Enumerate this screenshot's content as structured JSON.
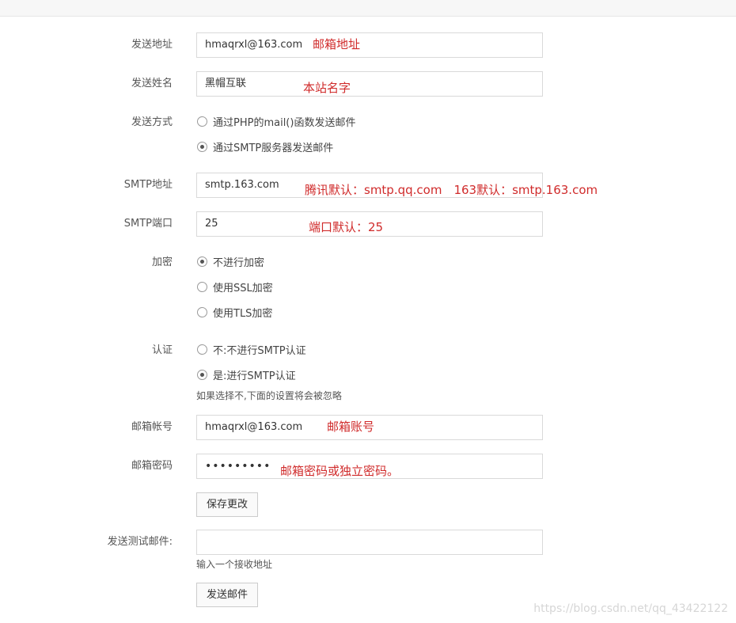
{
  "form": {
    "sender_address": {
      "label": "发送地址",
      "value": "hmaqrxl@163.com",
      "note": "邮箱地址"
    },
    "sender_name": {
      "label": "发送姓名",
      "value": "黑帽互联",
      "note": "本站名字"
    },
    "send_method": {
      "label": "发送方式",
      "options": [
        "通过PHP的mail()函数发送邮件",
        "通过SMTP服务器发送邮件"
      ],
      "selected_index": 1
    },
    "smtp_address": {
      "label": "SMTP地址",
      "value": "smtp.163.com",
      "note": "腾讯默认：smtp.qq.com　163默认：smtp.163.com"
    },
    "smtp_port": {
      "label": "SMTP端口",
      "value": "25",
      "note": "端口默认：25"
    },
    "encryption": {
      "label": "加密",
      "options": [
        "不进行加密",
        "使用SSL加密",
        "使用TLS加密"
      ],
      "selected_index": 0
    },
    "auth": {
      "label": "认证",
      "options": [
        "不:不进行SMTP认证",
        "是:进行SMTP认证"
      ],
      "selected_index": 1,
      "hint": "如果选择不,下面的设置将会被忽略"
    },
    "mail_account": {
      "label": "邮箱帐号",
      "value": "hmaqrxl@163.com",
      "note": "邮箱账号"
    },
    "mail_password": {
      "label": "邮箱密码",
      "value": "•••••••••",
      "note": "邮箱密码或独立密码。"
    },
    "save_button": "保存更改",
    "test_mail": {
      "label": "发送测试邮件:",
      "value": "",
      "hint": "输入一个接收地址"
    },
    "send_button": "发送邮件"
  },
  "watermark": "https://blog.csdn.net/qq_43422122"
}
